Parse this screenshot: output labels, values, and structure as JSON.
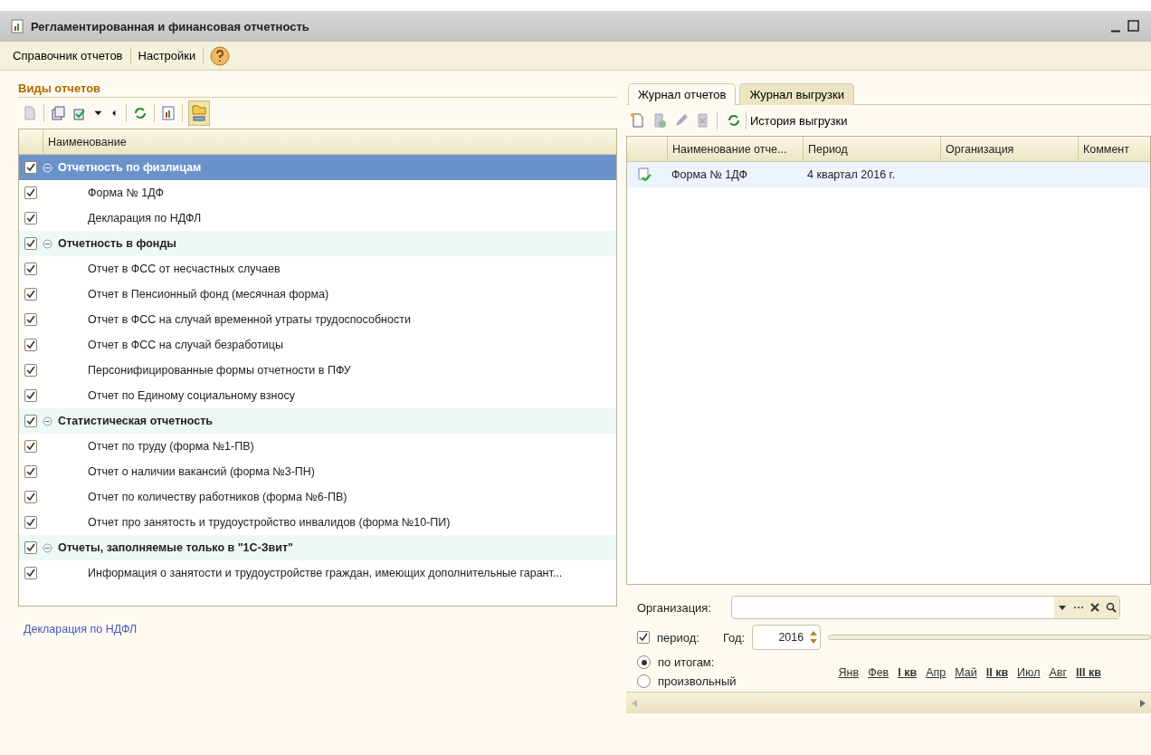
{
  "window": {
    "title": "Регламентированная и финансовая отчетность"
  },
  "menu": [
    "Справочник отчетов",
    "Настройки"
  ],
  "left": {
    "title": "Виды отчетов",
    "column": "Наименование",
    "tree": [
      {
        "label": "Отчетность по физлицам",
        "checked": true,
        "expanded": true,
        "selected": true,
        "children": [
          {
            "label": "Форма № 1ДФ",
            "checked": true,
            "selected": false
          },
          {
            "label": "Декларация по НДФЛ",
            "checked": true,
            "selected": false
          }
        ]
      },
      {
        "label": "Отчетность в фонды",
        "checked": true,
        "expanded": true,
        "selected": false,
        "children": [
          {
            "label": "Отчет в ФСС от несчастных случаев",
            "checked": true,
            "selected": false
          },
          {
            "label": "Отчет в Пенсионный фонд (месячная форма)",
            "checked": true,
            "selected": false
          },
          {
            "label": "Отчет в ФСС на случай временной утраты трудоспособности",
            "checked": true,
            "selected": false
          },
          {
            "label": "Отчет в ФСС на случай безработицы",
            "checked": true,
            "selected": false
          },
          {
            "label": "Персонифицированные формы отчетности в ПФУ",
            "checked": true,
            "selected": false
          },
          {
            "label": "Отчет по Единому социальному взносу",
            "checked": true,
            "selected": false
          }
        ]
      },
      {
        "label": "Статистическая отчетность",
        "checked": true,
        "expanded": true,
        "selected": false,
        "children": [
          {
            "label": "Отчет по труду (форма №1-ПВ)",
            "checked": true,
            "selected": false
          },
          {
            "label": "Отчет о наличии вакансий (форма №3-ПН)",
            "checked": true,
            "selected": false
          },
          {
            "label": "Отчет по количеству работников (форма №6-ПВ)",
            "checked": true,
            "selected": false
          },
          {
            "label": "Отчет про занятость и трудоустройство инвалидов (форма №10-ПИ)",
            "checked": true,
            "selected": false
          }
        ]
      },
      {
        "label": "Отчеты, заполняемые только в \"1С-Звит\"",
        "checked": true,
        "expanded": true,
        "selected": false,
        "children": [
          {
            "label": "Информация о занятости и трудоустройстве граждан, имеющих дополнительные гарант...",
            "checked": true,
            "selected": false
          }
        ]
      }
    ],
    "link": "Декларация по НДФЛ"
  },
  "right": {
    "tabs": [
      {
        "label": "Журнал отчетов",
        "selected": true
      },
      {
        "label": "Журнал выгрузки",
        "selected": false
      }
    ],
    "toolbar_text": "История выгрузки",
    "columns": [
      "Наименование отче...",
      "Период",
      "Организация",
      "Коммент"
    ],
    "rows": [
      [
        "Форма № 1ДФ",
        "4 квартал 2016 г.",
        "",
        ""
      ]
    ],
    "filter": {
      "org_label": "Организация:",
      "period_label": "период:",
      "period_checked": true,
      "year_label": "Год:",
      "year": "2016",
      "modes": [
        {
          "label": "по итогам:",
          "selected": true
        },
        {
          "label": "произвольный",
          "selected": false
        }
      ],
      "months": [
        {
          "label": "Янв",
          "kind": "month"
        },
        {
          "label": "Фев",
          "kind": "month"
        },
        {
          "label": "I кв",
          "kind": "quarter"
        },
        {
          "label": "Апр",
          "kind": "month"
        },
        {
          "label": "Май",
          "kind": "month"
        },
        {
          "label": "II кв",
          "kind": "quarter"
        },
        {
          "label": "Июл",
          "kind": "month"
        },
        {
          "label": "Авг",
          "kind": "month"
        },
        {
          "label": "III кв",
          "kind": "quarter"
        }
      ]
    }
  }
}
